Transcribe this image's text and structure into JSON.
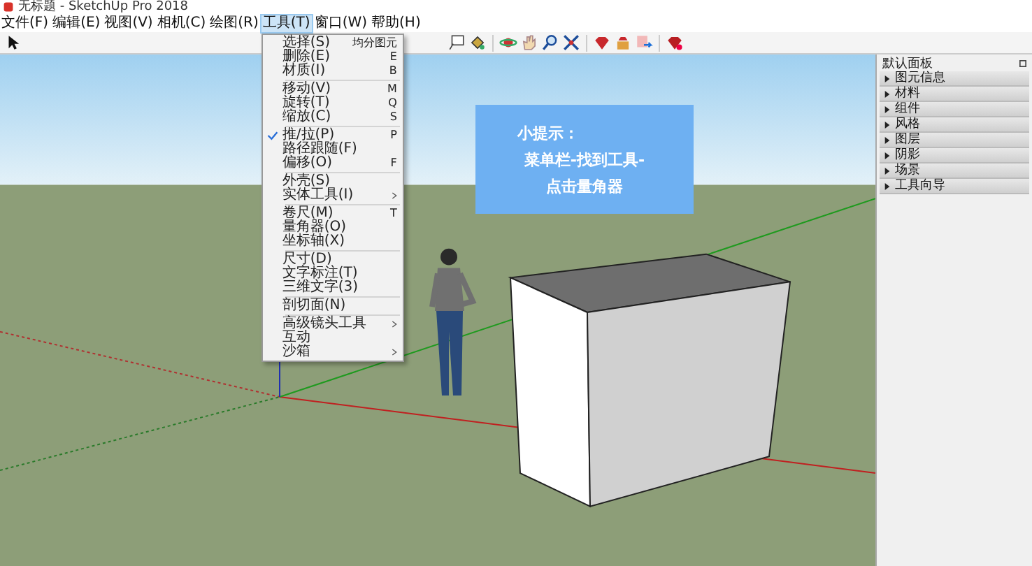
{
  "window": {
    "title": "无标题 - SketchUp Pro 2018"
  },
  "menu_bar": [
    {
      "label": "文件(F)",
      "selected": false
    },
    {
      "label": "编辑(E)",
      "selected": false
    },
    {
      "label": "视图(V)",
      "selected": false
    },
    {
      "label": "相机(C)",
      "selected": false
    },
    {
      "label": "绘图(R)",
      "selected": false
    },
    {
      "label": "工具(T)",
      "selected": true
    },
    {
      "label": "窗口(W)",
      "selected": false
    },
    {
      "label": "帮助(H)",
      "selected": false
    }
  ],
  "tools_menu": {
    "groups": [
      {
        "items": [
          {
            "label": "选择(S)",
            "shortcut": "均分图元",
            "checked": false,
            "submenu": false
          },
          {
            "label": "删除(E)",
            "shortcut": "E",
            "checked": false,
            "submenu": false
          },
          {
            "label": "材质(I)",
            "shortcut": "B",
            "checked": false,
            "submenu": false
          }
        ]
      },
      {
        "items": [
          {
            "label": "移动(V)",
            "shortcut": "M",
            "checked": false,
            "submenu": false
          },
          {
            "label": "旋转(T)",
            "shortcut": "Q",
            "checked": false,
            "submenu": false
          },
          {
            "label": "缩放(C)",
            "shortcut": "S",
            "checked": false,
            "submenu": false
          }
        ]
      },
      {
        "items": [
          {
            "label": "推/拉(P)",
            "shortcut": "P",
            "checked": true,
            "submenu": false
          },
          {
            "label": "路径跟随(F)",
            "checked": false,
            "submenu": false
          },
          {
            "label": "偏移(O)",
            "shortcut": "F",
            "checked": false,
            "submenu": false
          }
        ]
      },
      {
        "items": [
          {
            "label": "外壳(S)",
            "checked": false,
            "submenu": false
          },
          {
            "label": "实体工具(I)",
            "checked": false,
            "submenu": true
          }
        ]
      },
      {
        "items": [
          {
            "label": "卷尺(M)",
            "shortcut": "T",
            "checked": false,
            "submenu": false
          },
          {
            "label": "量角器(O)",
            "checked": false,
            "submenu": false
          },
          {
            "label": "坐标轴(X)",
            "checked": false,
            "submenu": false
          }
        ]
      },
      {
        "items": [
          {
            "label": "尺寸(D)",
            "checked": false,
            "submenu": false
          },
          {
            "label": "文字标注(T)",
            "checked": false,
            "submenu": false
          },
          {
            "label": "三维文字(3)",
            "checked": false,
            "submenu": false
          }
        ]
      },
      {
        "items": [
          {
            "label": "剖切面(N)",
            "checked": false,
            "submenu": false
          }
        ]
      },
      {
        "items": [
          {
            "label": "高级镜头工具",
            "checked": false,
            "submenu": true
          },
          {
            "label": "互动",
            "checked": false,
            "submenu": false
          },
          {
            "label": "沙箱",
            "checked": false,
            "submenu": true
          }
        ]
      }
    ]
  },
  "tray": {
    "title": "默认面板",
    "items": [
      {
        "label": "图元信息",
        "expanded": false
      },
      {
        "label": "材料",
        "expanded": false
      },
      {
        "label": "组件",
        "expanded": false
      },
      {
        "label": "风格",
        "expanded": false
      },
      {
        "label": "图层",
        "expanded": false
      },
      {
        "label": "阴影",
        "expanded": false
      },
      {
        "label": "场景",
        "expanded": false
      },
      {
        "label": "工具向导",
        "expanded": false
      }
    ]
  },
  "tip": {
    "lines": [
      "小提示：",
      "菜单栏-找到工具-",
      "点击量角器"
    ]
  }
}
